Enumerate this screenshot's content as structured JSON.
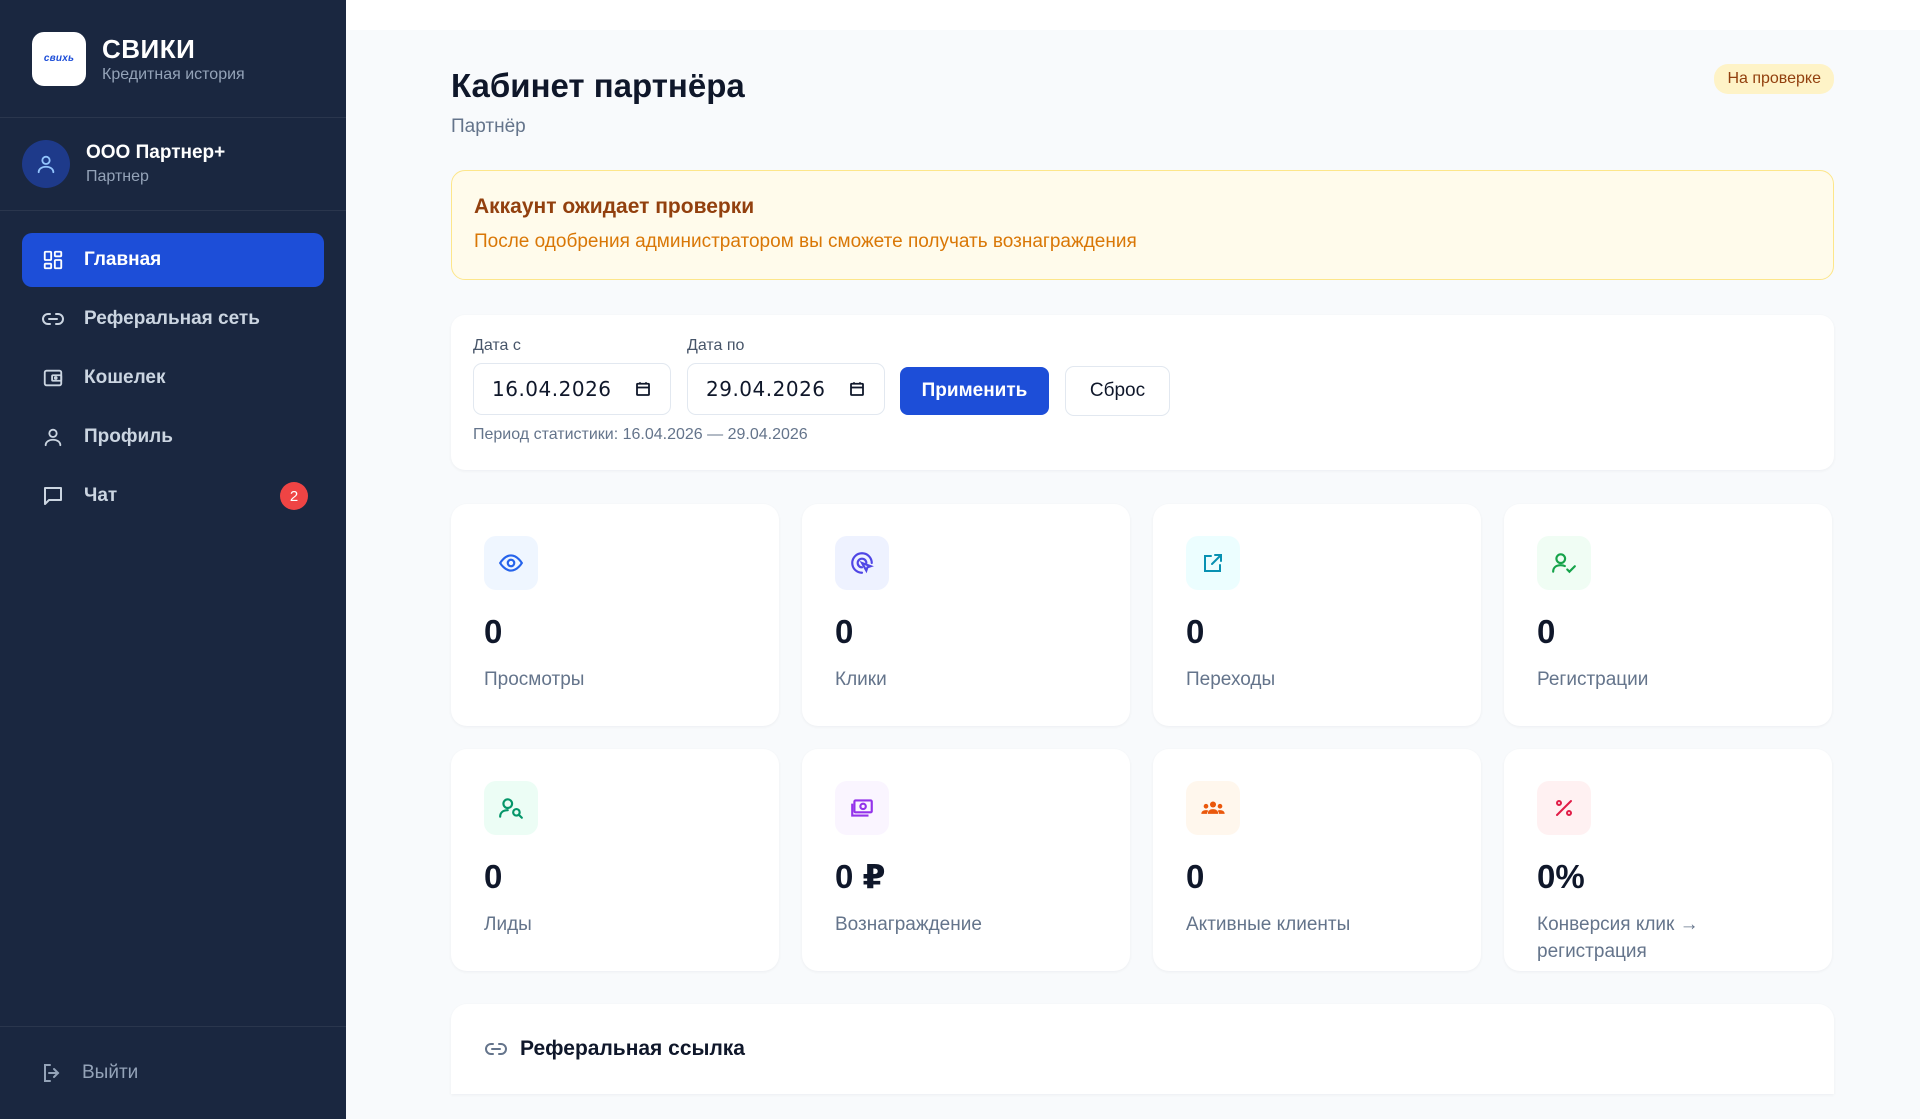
{
  "brand": {
    "logo_text": "свихь",
    "name": "СВИКИ",
    "subtitle": "Кредитная история"
  },
  "user": {
    "name": "ООО Партнер+",
    "role": "Партнер",
    "avatar_icon": "user-icon"
  },
  "nav": {
    "items": [
      {
        "label": "Главная",
        "icon": "grid-icon",
        "active": true
      },
      {
        "label": "Реферальная сеть",
        "icon": "link-icon",
        "active": false
      },
      {
        "label": "Кошелек",
        "icon": "wallet-icon",
        "active": false
      },
      {
        "label": "Профиль",
        "icon": "user-icon",
        "active": false
      },
      {
        "label": "Чат",
        "icon": "chat-icon",
        "active": false,
        "badge": "2"
      }
    ],
    "logout_label": "Выйти"
  },
  "header": {
    "title": "Кабинет партнёра",
    "subtitle": "Партнёр",
    "status": "На проверке"
  },
  "alert": {
    "title": "Аккаунт ожидает проверки",
    "text": "После одобрения администратором вы сможете получать вознаграждения"
  },
  "filters": {
    "from_label": "Дата с",
    "from_value": "16.04.2026",
    "to_label": "Дата по",
    "to_value": "29.04.2026",
    "apply_label": "Применить",
    "reset_label": "Сброс",
    "period_text": "Период статистики: 16.04.2026 — 29.04.2026"
  },
  "stats": [
    {
      "value": "0",
      "label": "Просмотры",
      "icon": "eye-icon",
      "color": "#2563eb",
      "bg": "#eff6ff"
    },
    {
      "value": "0",
      "label": "Клики",
      "icon": "cursor-click-icon",
      "color": "#4f46e5",
      "bg": "#eef2ff"
    },
    {
      "value": "0",
      "label": "Переходы",
      "icon": "external-link-icon",
      "color": "#0891b2",
      "bg": "#ecfeff"
    },
    {
      "value": "0",
      "label": "Регистрации",
      "icon": "user-check-icon",
      "color": "#16a34a",
      "bg": "#f0fdf4"
    },
    {
      "value": "0",
      "label": "Лиды",
      "icon": "user-search-icon",
      "color": "#059669",
      "bg": "#ecfdf5"
    },
    {
      "value": "0 ₽",
      "label": "Вознаграждение",
      "icon": "money-icon",
      "color": "#9333ea",
      "bg": "#faf5ff"
    },
    {
      "value": "0",
      "label": "Активные клиенты",
      "icon": "users-icon",
      "color": "#ea580c",
      "bg": "#fff7ed"
    },
    {
      "value": "0%",
      "label": "Конверсия клик → регистрация",
      "icon": "percent-icon",
      "color": "#e11d48",
      "bg": "#fff1f2"
    }
  ],
  "referral": {
    "title": "Реферальная ссылка",
    "icon": "link-icon"
  }
}
